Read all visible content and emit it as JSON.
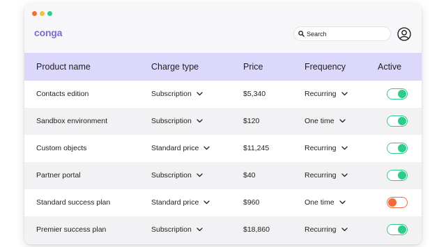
{
  "window": {
    "dot_colors": [
      "#f26b3a",
      "#f5c03a",
      "#2ecc8a"
    ]
  },
  "app": {
    "logo_text": "conga"
  },
  "search": {
    "placeholder": "Search",
    "icon": "search-icon"
  },
  "user": {
    "icon": "user-avatar-icon"
  },
  "table": {
    "headers": [
      "Product name",
      "Charge type",
      "Price",
      "Frequency",
      "Active"
    ],
    "rows": [
      {
        "product": "Contacts edition",
        "charge_type": "Subscription",
        "price": "$5,340",
        "frequency": "Recurring",
        "active": true
      },
      {
        "product": "Sandbox environment",
        "charge_type": "Subscription",
        "price": "$120",
        "frequency": "One time",
        "active": true
      },
      {
        "product": "Custom objects",
        "charge_type": "Standard price",
        "price": "$11,245",
        "frequency": "Recurring",
        "active": true
      },
      {
        "product": "Partner portal",
        "charge_type": "Subscription",
        "price": "$40",
        "frequency": "Recurring",
        "active": true
      },
      {
        "product": "Standard success plan",
        "charge_type": "Standard price",
        "price": "$960",
        "frequency": "One time",
        "active": false
      },
      {
        "product": "Premier success plan",
        "charge_type": "Subscription",
        "price": "$18,860",
        "frequency": "Recurring",
        "active": true
      }
    ]
  },
  "colors": {
    "accent": "#7b6ad6",
    "header_bg": "#dcd8fb",
    "toggle_on": "#2ecc8a",
    "toggle_off": "#f26b3a"
  }
}
